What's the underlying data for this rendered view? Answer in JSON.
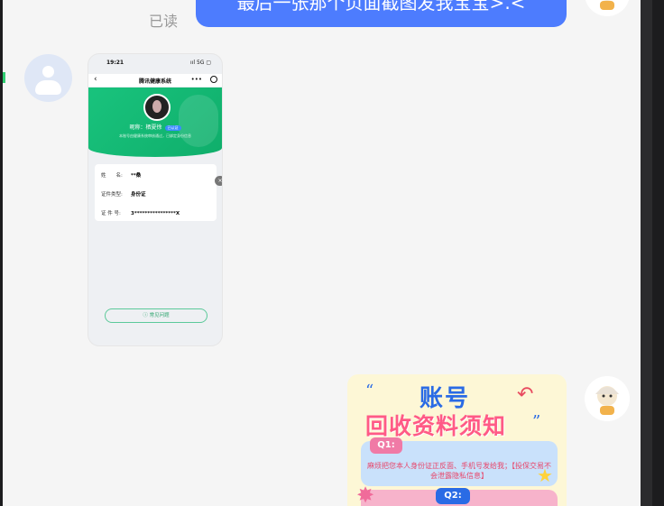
{
  "conversation": {
    "read_status": "已读",
    "outgoing_message": "最后一张那个页面截图发我宝宝>.<"
  },
  "screenshot_message": {
    "time": "19:21",
    "signal": "ııl 5G ▢",
    "nav_title": "腾讯健康系统",
    "back": "‹",
    "more": "•••",
    "nickname": "昵称：栖夏徐",
    "badge": "已认证",
    "note": "本账号由健康系统审核通过，已绑定身份信息",
    "fields": [
      {
        "key": "姓　　名:",
        "value": "**桑"
      },
      {
        "key": "证件类型:",
        "value": "身份证"
      },
      {
        "key": "证 件 号:",
        "value": "3****************X"
      }
    ],
    "close": "×",
    "faq": "ⓘ 常见问题"
  },
  "poster_message": {
    "quote_open": "“",
    "title_1": "账号",
    "title_2": "回收资料须知",
    "quote_close": "”",
    "q1_tag": "Q1:",
    "q1_text": "麻烦把您本人身份证正反面、手机号发给我；【投保交易不会泄露隐私信息】",
    "q2_tag": "Q2:"
  },
  "colors": {
    "outgoing_bubble": "#4d7cfe",
    "chat_background": "#f5f5f5",
    "health_green": "#19c37d"
  }
}
